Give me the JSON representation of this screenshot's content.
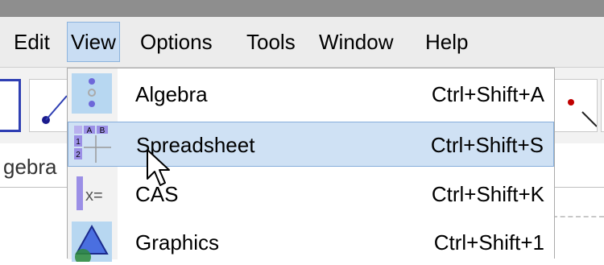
{
  "menubar": {
    "items": [
      {
        "label": "Edit",
        "active": false
      },
      {
        "label": "View",
        "active": true
      },
      {
        "label": "Options",
        "active": false
      },
      {
        "label": "Tools",
        "active": false
      },
      {
        "label": "Window",
        "active": false
      },
      {
        "label": "Help",
        "active": false
      }
    ]
  },
  "view_menu": {
    "items": [
      {
        "label": "Algebra",
        "shortcut": "Ctrl+Shift+A",
        "icon": "algebra-view-icon",
        "highlighted": false
      },
      {
        "label": "Spreadsheet",
        "shortcut": "Ctrl+Shift+S",
        "icon": "spreadsheet-view-icon",
        "highlighted": true
      },
      {
        "label": "CAS",
        "shortcut": "Ctrl+Shift+K",
        "icon": "cas-view-icon",
        "highlighted": false
      },
      {
        "label": "Graphics",
        "shortcut": "Ctrl+Shift+1",
        "icon": "graphics-view-icon",
        "highlighted": false
      }
    ]
  },
  "background": {
    "view_label": "gebra"
  },
  "colors": {
    "menu_highlight": "#cfe1f4",
    "menu_highlight_border": "#86aedb",
    "tool_selected_border": "#2f3fb3",
    "icon_purple": "#9b8fe6"
  }
}
